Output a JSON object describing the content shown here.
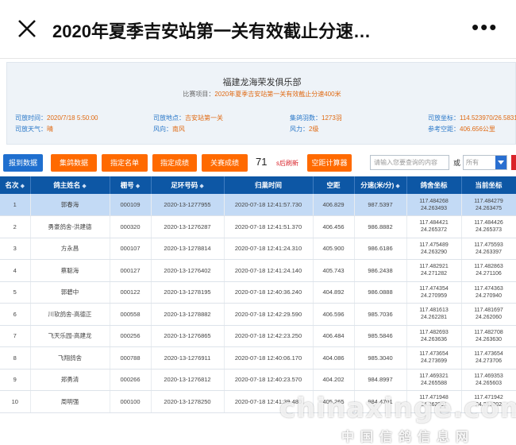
{
  "window": {
    "title": "2020年夏季吉安站第一关有效截止分速…",
    "more_label": "•••"
  },
  "header": {
    "club": "福建龙海荣发俱乐部",
    "project_label": "比赛项目：",
    "project_value": "2020年夏季吉安站第一关有效截止分速400米"
  },
  "info": {
    "release_time": {
      "key": "司放时间：",
      "value": "2020/7/18 5:50:00"
    },
    "release_place": {
      "key": "司放地点：",
      "value": "吉安站第一关"
    },
    "collected": {
      "key": "集鸽羽数：",
      "value": "1273羽"
    },
    "coords": {
      "key": "司放坐标：",
      "value": "114.523970/26.58316"
    },
    "weather": {
      "key": "司放天气：",
      "value": "晴"
    },
    "wind_dir": {
      "key": "风向：",
      "value": "南风"
    },
    "wind_force": {
      "key": "风力：",
      "value": "2级"
    },
    "ref_distance": {
      "key": "参考空距：",
      "value": "406.656公里"
    }
  },
  "toolbar": {
    "buttons": [
      "报到数据",
      "集鸽数据",
      "指定名单",
      "指定成绩",
      "关赛成绩"
    ],
    "count": "71",
    "refresh": "s后刷新",
    "calc": "空距计算器",
    "search_placeholder": "请输入您要查询的内容",
    "or": "或",
    "select_value": "所有"
  },
  "table": {
    "headers": [
      "名次",
      "鸽主姓名",
      "棚号",
      "足环号码",
      "归巢时间",
      "空距",
      "分速(米/分)",
      "鸽舍坐标",
      "当前坐标"
    ],
    "rows": [
      {
        "rank": "1",
        "name": "郭春海",
        "loft": "000109",
        "ring": "2020-13-1277955",
        "time": "2020-07-18 12:41:57.730",
        "dist": "406.829",
        "speed": "987.5397",
        "loft_c1": "117.484268",
        "loft_c2": "24.263493",
        "cur_c1": "117.484279",
        "cur_c2": "24.263475"
      },
      {
        "rank": "2",
        "name": "勇豪鸽舍-洪建德",
        "loft": "000320",
        "ring": "2020-13-1276287",
        "time": "2020-07-18 12:41:51.370",
        "dist": "406.456",
        "speed": "986.8882",
        "loft_c1": "117.484421",
        "loft_c2": "24.265372",
        "cur_c1": "117.484426",
        "cur_c2": "24.265373"
      },
      {
        "rank": "3",
        "name": "方永昌",
        "loft": "000107",
        "ring": "2020-13-1278814",
        "time": "2020-07-18 12:41:24.310",
        "dist": "405.900",
        "speed": "986.6186",
        "loft_c1": "117.475489",
        "loft_c2": "24.263290",
        "cur_c1": "117.475593",
        "cur_c2": "24.263397"
      },
      {
        "rank": "4",
        "name": "蔡聪海",
        "loft": "000127",
        "ring": "2020-13-1276402",
        "time": "2020-07-18 12:41:24.140",
        "dist": "405.743",
        "speed": "986.2438",
        "loft_c1": "117.482921",
        "loft_c2": "24.271282",
        "cur_c1": "117.482863",
        "cur_c2": "24.271106"
      },
      {
        "rank": "5",
        "name": "郭碧中",
        "loft": "000122",
        "ring": "2020-13-1278195",
        "time": "2020-07-18 12:40:36.240",
        "dist": "404.892",
        "speed": "986.0888",
        "loft_c1": "117.474354",
        "loft_c2": "24.270959",
        "cur_c1": "117.474363",
        "cur_c2": "24.270940"
      },
      {
        "rank": "6",
        "name": "川软鸽舍-高德正",
        "loft": "000558",
        "ring": "2020-13-1278882",
        "time": "2020-07-18 12:42:29.590",
        "dist": "406.596",
        "speed": "985.7036",
        "loft_c1": "117.481613",
        "loft_c2": "24.262281",
        "cur_c1": "117.481697",
        "cur_c2": "24.262060"
      },
      {
        "rank": "7",
        "name": "飞天乐园-高建龙",
        "loft": "000256",
        "ring": "2020-13-1276865",
        "time": "2020-07-18 12:42:23.250",
        "dist": "406.484",
        "speed": "985.5846",
        "loft_c1": "117.482693",
        "loft_c2": "24.263636",
        "cur_c1": "117.482708",
        "cur_c2": "24.263630"
      },
      {
        "rank": "8",
        "name": "飞翔鸽舍",
        "loft": "000788",
        "ring": "2020-13-1276911",
        "time": "2020-07-18 12:40:06.170",
        "dist": "404.086",
        "speed": "985.3040",
        "loft_c1": "117.473654",
        "loft_c2": "24.273699",
        "cur_c1": "117.473654",
        "cur_c2": "24.273706"
      },
      {
        "rank": "9",
        "name": "郑勇清",
        "loft": "000266",
        "ring": "2020-13-1276812",
        "time": "2020-07-18 12:40:23.570",
        "dist": "404.202",
        "speed": "984.8997",
        "loft_c1": "117.469321",
        "loft_c2": "24.265588",
        "cur_c1": "117.469353",
        "cur_c2": "24.265603"
      },
      {
        "rank": "10",
        "name": "周明强",
        "loft": "000100",
        "ring": "2020-13-1278250",
        "time": "2020-07-18 12:41:39.480",
        "dist": "405.265",
        "speed": "984.4701",
        "loft_c1": "117.471948",
        "loft_c2": "24.262991",
        "cur_c1": "117.471942",
        "cur_c2": "24.263002"
      }
    ]
  },
  "watermark": {
    "domain": "chinaxinge.com",
    "sub": "中国信鸽信息网"
  },
  "colors": {
    "accent_blue": "#0d57a5",
    "button_orange": "#ff6a00",
    "value_orange": "#e06a13",
    "selected_row": "#c3daf5"
  }
}
